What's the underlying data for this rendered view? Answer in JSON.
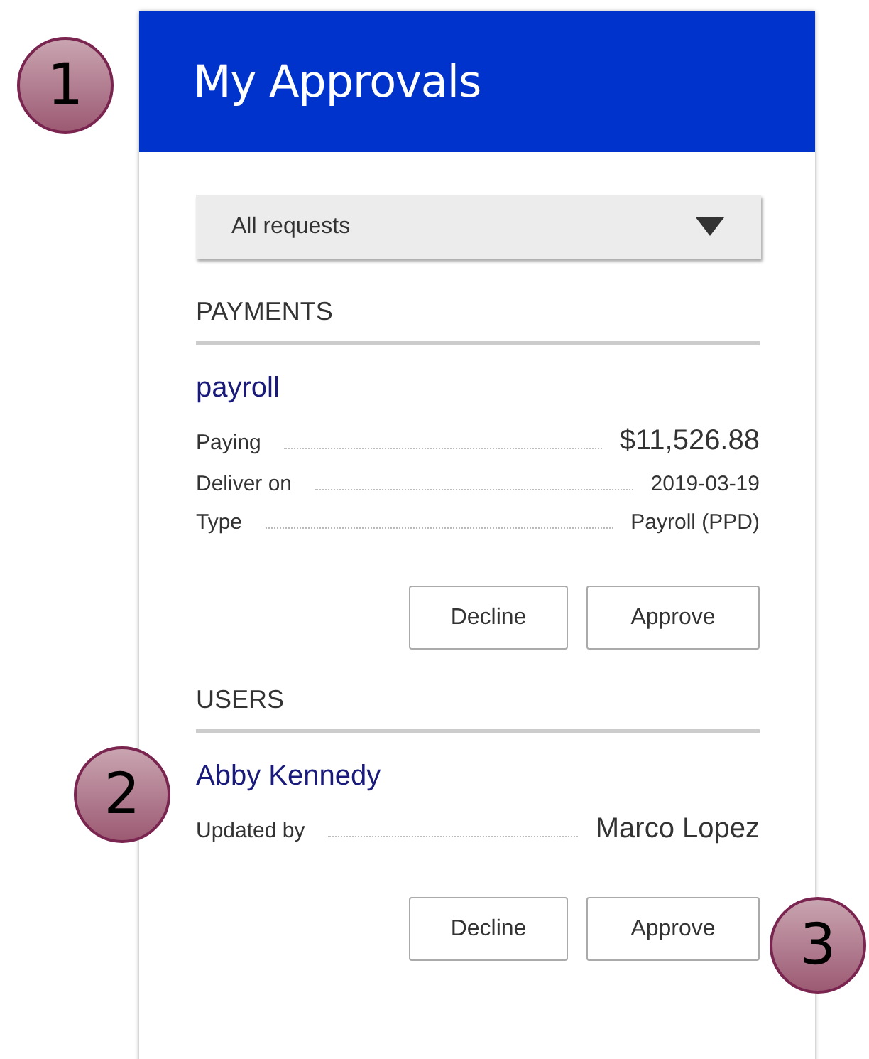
{
  "header": {
    "title": "My Approvals"
  },
  "filter": {
    "value": "All requests"
  },
  "sections": [
    {
      "heading": "PAYMENTS",
      "items": [
        {
          "title": "payroll",
          "fields": [
            {
              "label": "Paying",
              "value": "$11,526.88",
              "kind": "large"
            },
            {
              "label": "Deliver on",
              "value": "2019-03-19",
              "kind": "normal"
            },
            {
              "label": "Type",
              "value": "Payroll (PPD)",
              "kind": "normal"
            }
          ],
          "actions": [
            "Decline",
            "Approve"
          ]
        }
      ]
    },
    {
      "heading": "USERS",
      "items": [
        {
          "title": "Abby Kennedy",
          "fields": [
            {
              "label": "Updated by",
              "value": "Marco Lopez",
              "kind": "large"
            }
          ],
          "actions": [
            "Decline",
            "Approve"
          ]
        }
      ]
    }
  ],
  "callouts": [
    {
      "number": "1"
    },
    {
      "number": "2"
    },
    {
      "number": "3"
    }
  ]
}
